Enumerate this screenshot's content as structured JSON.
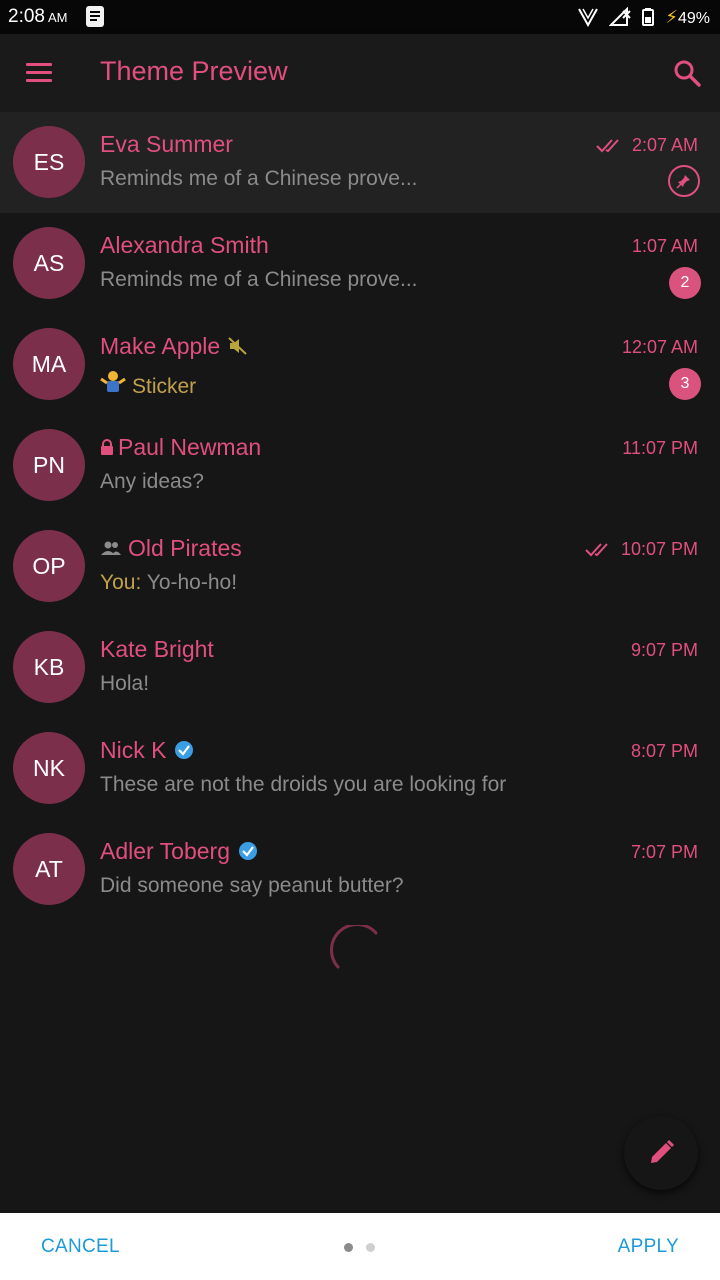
{
  "status_bar": {
    "time": "2:08",
    "ampm": "AM",
    "battery": "49%"
  },
  "app_bar": {
    "title": "Theme Preview"
  },
  "chats": [
    {
      "initials": "ES",
      "name": "Eva Summer",
      "time": "2:07 AM",
      "message": "Reminds me of a Chinese prove...",
      "read": true,
      "pinned": true
    },
    {
      "initials": "AS",
      "name": "Alexandra Smith",
      "time": "1:07 AM",
      "message": "Reminds me of a Chinese prove...",
      "unread": "2"
    },
    {
      "initials": "MA",
      "name": "Make Apple",
      "time": "12:07 AM",
      "message": "Sticker",
      "muted": true,
      "unread": "3"
    },
    {
      "initials": "PN",
      "name": "Paul Newman",
      "time": "11:07 PM",
      "message": "Any ideas?",
      "secret": true
    },
    {
      "initials": "OP",
      "name": "Old Pirates",
      "time": "10:07 PM",
      "sender": "You:",
      "message": "Yo-ho-ho!",
      "group": true,
      "read": true
    },
    {
      "initials": "KB",
      "name": "Kate Bright",
      "time": "9:07 PM",
      "message": "Hola!"
    },
    {
      "initials": "NK",
      "name": "Nick K",
      "time": "8:07 PM",
      "message": "These are not the droids you are looking for",
      "verified": true
    },
    {
      "initials": "AT",
      "name": "Adler Toberg",
      "time": "7:07 PM",
      "message": "Did someone say peanut butter?",
      "verified": true
    }
  ],
  "bottom_bar": {
    "cancel": "CANCEL",
    "apply": "APPLY"
  },
  "colors": {
    "accent": "#e04f7e",
    "avatar": "#7c2f4b",
    "background": "#161616",
    "bottom_button": "#1d9bd9"
  }
}
